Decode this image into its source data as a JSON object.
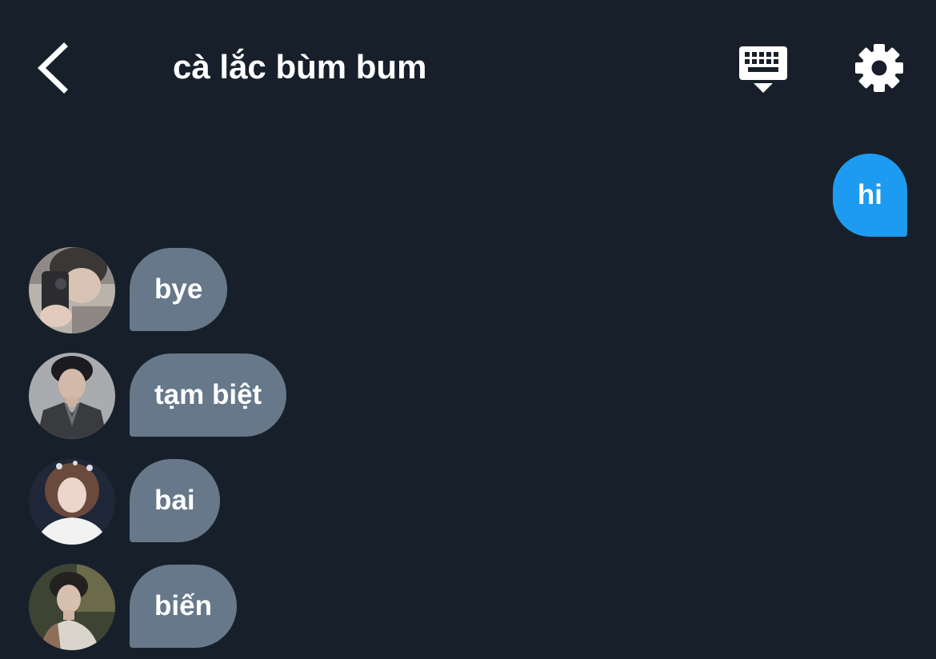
{
  "theme": {
    "background": "#17202a",
    "text": "#ffffff",
    "outgoing_bubble": "#1d9bf0",
    "incoming_bubble": "#66788a"
  },
  "header": {
    "back_icon": "chevron-left-icon",
    "title": "cà lắc bùm bum",
    "keyboard_icon": "keyboard-icon",
    "settings_icon": "gear-icon"
  },
  "messages": {
    "outgoing": [
      {
        "text": "hi"
      }
    ],
    "incoming": [
      {
        "text": "bye"
      },
      {
        "text": "tạm biệt"
      },
      {
        "text": "bai"
      },
      {
        "text": "biến"
      }
    ]
  }
}
